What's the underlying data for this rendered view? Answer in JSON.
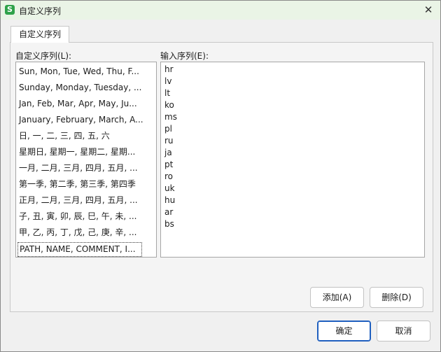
{
  "window": {
    "title": "自定义序列",
    "app_icon": "S",
    "close_glyph": "✕"
  },
  "tab": {
    "label": "自定义序列"
  },
  "left": {
    "label": "自定义序列(L):",
    "items": [
      "Sun, Mon, Tue, Wed, Thu, F...",
      "Sunday, Monday, Tuesday, ...",
      "Jan, Feb, Mar, Apr, May, Ju...",
      "January, February, March, A...",
      "日, 一, 二, 三, 四, 五, 六",
      "星期日, 星期一, 星期二, 星期...",
      "一月, 二月, 三月, 四月, 五月, ...",
      "第一季, 第二季, 第三季, 第四季",
      "正月, 二月, 三月, 四月, 五月, ...",
      "子, 丑, 寅, 卯, 辰, 巳, 午, 未, ...",
      "甲, 乙, 丙, 丁, 戊, 己, 庚, 辛, ...",
      "PATH, NAME, COMMENT, I..."
    ],
    "selected_index": 11
  },
  "right": {
    "label": "输入序列(E):",
    "lines": [
      "hr",
      "lv",
      "lt",
      "ko",
      "ms",
      "pl",
      "ru",
      "ja",
      "pt",
      "ro",
      "uk",
      "hu",
      "ar",
      "bs"
    ]
  },
  "buttons": {
    "add": "添加(A)",
    "delete": "删除(D)",
    "ok": "确定",
    "cancel": "取消"
  },
  "colors": {
    "titlebar": "#eaf4e6",
    "app_icon": "#2fa24a",
    "primary_border": "#1f5fbf"
  },
  "icons": {
    "app": "app-logo-icon",
    "close": "close-icon"
  }
}
